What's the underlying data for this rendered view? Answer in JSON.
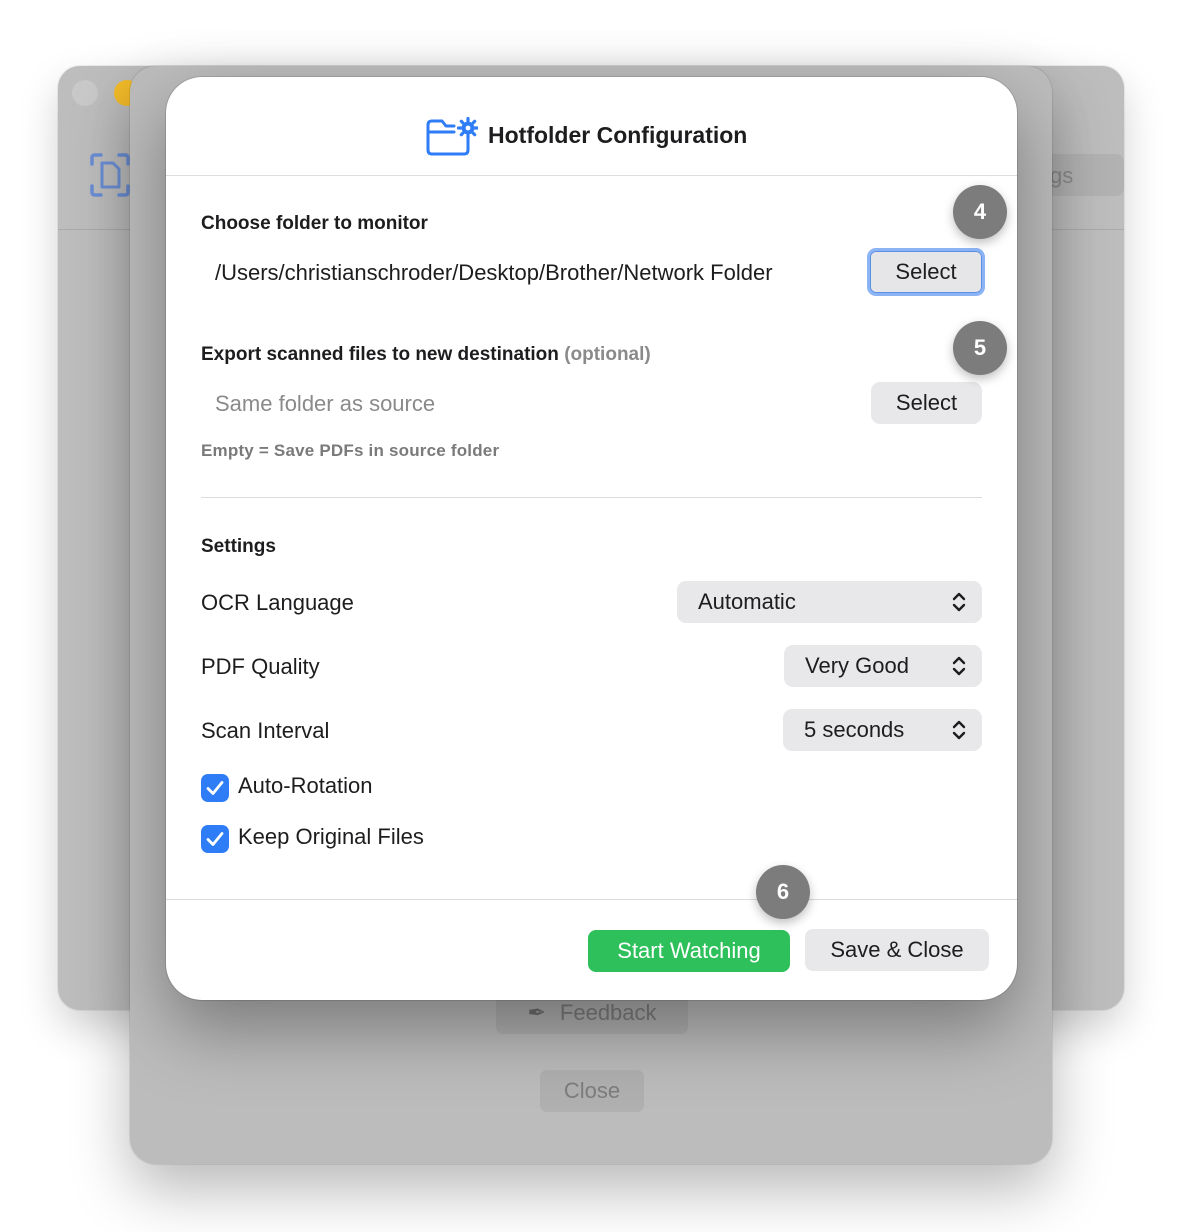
{
  "background_window": {
    "partial_label": "gs"
  },
  "sheet": {
    "feedback_label": "Feedback",
    "close_label": "Close"
  },
  "dialog": {
    "title": "Hotfolder Configuration",
    "monitor": {
      "label": "Choose folder to monitor",
      "path": "/Users/christianschroder/Desktop/Brother/Network Folder",
      "select_label": "Select"
    },
    "export": {
      "label": "Export scanned files to new destination",
      "optional": "(optional)",
      "placeholder": "Same folder as source",
      "select_label": "Select",
      "hint": "Empty = Save PDFs in source folder"
    },
    "settings": {
      "heading": "Settings",
      "ocr_language": {
        "label": "OCR Language",
        "value": "Automatic"
      },
      "pdf_quality": {
        "label": "PDF Quality",
        "value": "Very Good"
      },
      "scan_interval": {
        "label": "Scan Interval",
        "value": "5 seconds"
      },
      "auto_rotation": {
        "label": "Auto-Rotation",
        "checked": true
      },
      "keep_original": {
        "label": "Keep Original Files",
        "checked": true
      }
    },
    "footer": {
      "start_label": "Start Watching",
      "save_label": "Save & Close"
    }
  },
  "markers": [
    "4",
    "5",
    "6"
  ],
  "colors": {
    "accent_blue": "#2f7df6",
    "start_green": "#2ec05a",
    "marker_gray": "#7c7c7c",
    "minimize_yellow": "#f5bd2a"
  }
}
